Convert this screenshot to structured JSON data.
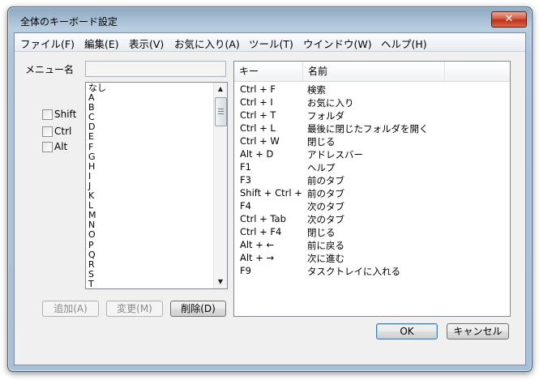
{
  "window": {
    "title": "全体のキーボード設定",
    "close_label": "✕"
  },
  "menubar": [
    "ファイル(F)",
    "編集(E)",
    "表示(V)",
    "お気に入り(A)",
    "ツール(T)",
    "ウインドウ(W)",
    "ヘルプ(H)"
  ],
  "form": {
    "menu_name_label": "メニュー名",
    "menu_name_value": "",
    "modifiers": [
      "Shift",
      "Ctrl",
      "Alt"
    ]
  },
  "key_list": [
    "なし",
    "A",
    "B",
    "C",
    "D",
    "E",
    "F",
    "G",
    "H",
    "I",
    "J",
    "K",
    "L",
    "M",
    "N",
    "O",
    "P",
    "Q",
    "R",
    "S",
    "T"
  ],
  "buttons": {
    "add": "追加(A)",
    "change": "変更(M)",
    "delete": "削除(D)",
    "ok": "OK",
    "cancel": "キャンセル"
  },
  "shortcuts": {
    "columns": [
      "キー",
      "名前"
    ],
    "rows": [
      {
        "key": "Ctrl + F",
        "name": "検索"
      },
      {
        "key": "Ctrl + I",
        "name": "お気に入り"
      },
      {
        "key": "Ctrl + T",
        "name": "フォルダ"
      },
      {
        "key": "Ctrl + L",
        "name": "最後に閉じたフォルダを開く"
      },
      {
        "key": "Ctrl + W",
        "name": "閉じる"
      },
      {
        "key": "Alt + D",
        "name": "アドレスバー"
      },
      {
        "key": "F1",
        "name": "ヘルプ"
      },
      {
        "key": "F3",
        "name": "前のタブ"
      },
      {
        "key": "Shift + Ctrl + ...",
        "name": "前のタブ"
      },
      {
        "key": "F4",
        "name": "次のタブ"
      },
      {
        "key": "Ctrl + Tab",
        "name": "次のタブ"
      },
      {
        "key": "Ctrl + F4",
        "name": "閉じる"
      },
      {
        "key": "Alt + ←",
        "name": "前に戻る"
      },
      {
        "key": "Alt + →",
        "name": "次に進む"
      },
      {
        "key": "F9",
        "name": "タスクトレイに入れる"
      }
    ]
  }
}
